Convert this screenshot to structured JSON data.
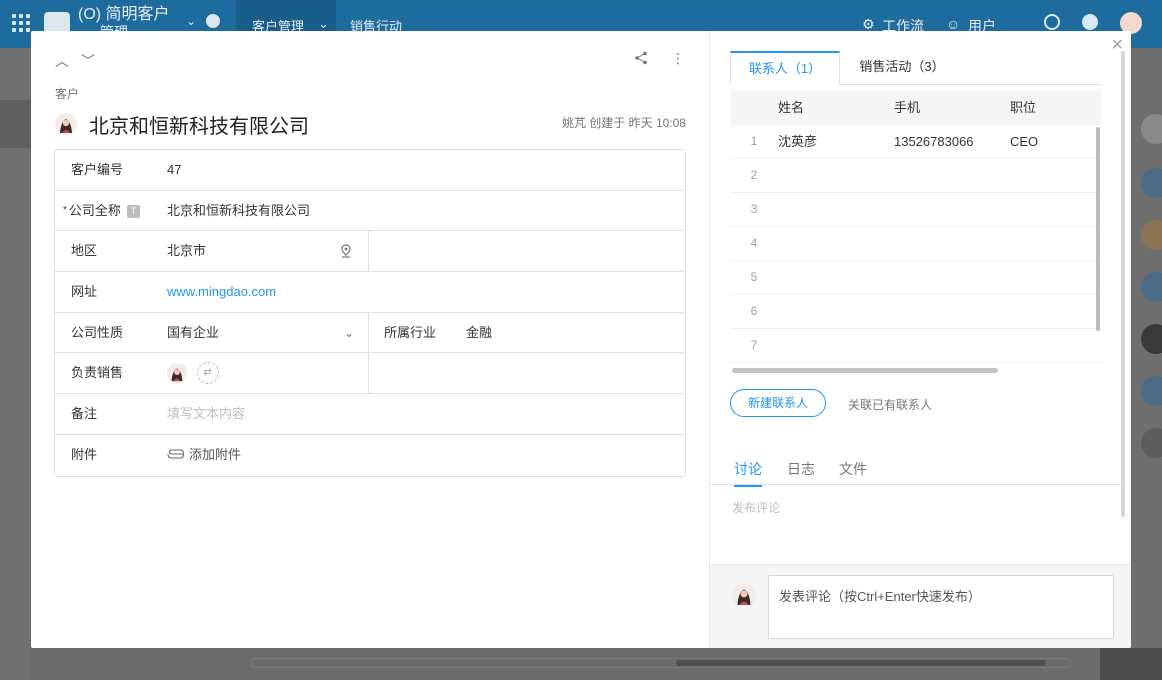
{
  "app": {
    "title": "(O) 简明客户",
    "subtitle": "管理",
    "nav_tabs": [
      "客户管理",
      "销售行动"
    ],
    "right_items": [
      "工作流",
      "用户"
    ]
  },
  "record": {
    "nav_up": "︿",
    "nav_down": "﹀",
    "type_label": "客户",
    "title": "北京和恒新科技有限公司",
    "meta": "姚芃 创建于 昨天 10:08",
    "more": "⋮"
  },
  "fields": {
    "customer_no": {
      "label": "客户编号",
      "value": "47"
    },
    "full_name": {
      "required": "*",
      "label": "公司全称",
      "badge": "T",
      "value": "北京和恒新科技有限公司"
    },
    "region": {
      "label": "地区",
      "value": "北京市"
    },
    "website": {
      "label": "网址",
      "value": "www.mingdao.com"
    },
    "nature": {
      "label": "公司性质",
      "value": "国有企业",
      "chevron": "⌄"
    },
    "industry": {
      "label": "所属行业",
      "value": "金融"
    },
    "sales_owner": {
      "label": "负责销售",
      "swap": "⇄"
    },
    "remark": {
      "label": "备注",
      "placeholder": "填写文本内容"
    },
    "attachment": {
      "label": "附件",
      "add": "添加附件"
    }
  },
  "related": {
    "tabs": [
      {
        "label": "联系人（1）"
      },
      {
        "label": "销售活动（3）"
      }
    ],
    "columns": [
      "姓名",
      "手机",
      "职位"
    ],
    "rows": [
      {
        "idx": "1",
        "name": "沈英彦",
        "phone": "13526783066",
        "title": "CEO"
      },
      {
        "idx": "2",
        "name": "",
        "phone": "",
        "title": ""
      },
      {
        "idx": "3",
        "name": "",
        "phone": "",
        "title": ""
      },
      {
        "idx": "4",
        "name": "",
        "phone": "",
        "title": ""
      },
      {
        "idx": "5",
        "name": "",
        "phone": "",
        "title": ""
      },
      {
        "idx": "6",
        "name": "",
        "phone": "",
        "title": ""
      },
      {
        "idx": "7",
        "name": "",
        "phone": "",
        "title": ""
      }
    ],
    "new_contact": "新建联系人",
    "link_contact": "关联已有联系人"
  },
  "discussion": {
    "tabs": [
      "讨论",
      "日志",
      "文件"
    ],
    "publish_hint": "发布评论",
    "comment_placeholder": "发表评论（按Ctrl+Enter快速发布）"
  },
  "close": "×",
  "colors": {
    "accent": "#2196f3",
    "topbar": "#1e6b9e"
  }
}
